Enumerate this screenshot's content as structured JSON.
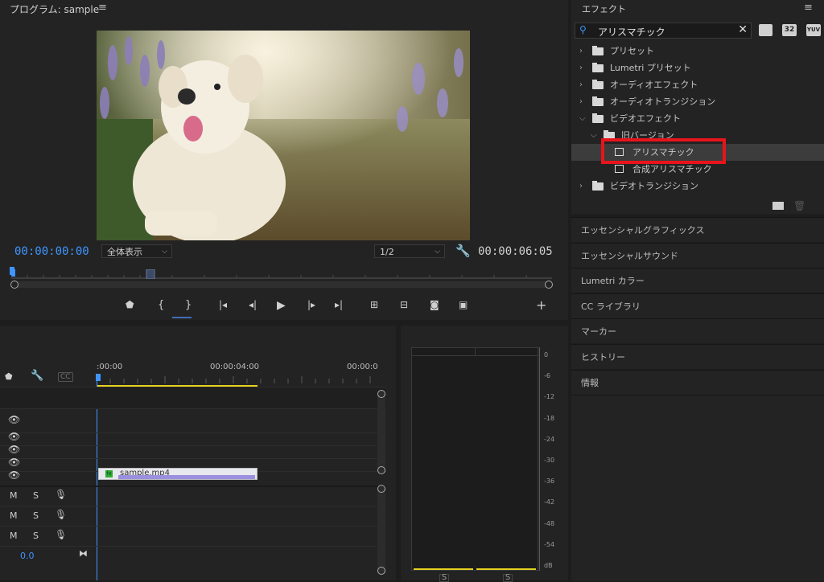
{
  "program": {
    "title": "プログラム: sample",
    "menu_icon": "hamburger-menu-icon",
    "timecode_current": "00:00:00:00",
    "timecode_duration": "00:00:06:05",
    "zoom_select": "全体表示",
    "resolution_select": "1/2"
  },
  "timeline": {
    "ruler": [
      "00:00",
      "00:00:04:00",
      "00:00:0"
    ],
    "ruler_prefix": ":",
    "clip_name": "sample.mp4",
    "clip_badge": "fx",
    "track_M": "M",
    "track_S": "S",
    "volume": "0.0",
    "cc_label": "CC"
  },
  "meter": {
    "scale": [
      "0",
      "-6",
      "-12",
      "-18",
      "-24",
      "-30",
      "-36",
      "-42",
      "-48",
      "-54",
      "dB"
    ],
    "solo_left": "S",
    "solo_right": "S"
  },
  "effects": {
    "title": "エフェクト",
    "search_value": "アリスマチック",
    "btn_32": "32",
    "btn_yuv": "YUV",
    "tree": [
      {
        "label": "プリセット",
        "indent": 0,
        "expanded": false
      },
      {
        "label": "Lumetri プリセット",
        "indent": 0,
        "expanded": false
      },
      {
        "label": "オーディオエフェクト",
        "indent": 0,
        "expanded": false
      },
      {
        "label": "オーディオトランジション",
        "indent": 0,
        "expanded": false
      },
      {
        "label": "ビデオエフェクト",
        "indent": 0,
        "expanded": true
      },
      {
        "label": "旧バージョン",
        "indent": 1,
        "expanded": true
      },
      {
        "label": "アリスマチック",
        "indent": 2,
        "selected": true
      },
      {
        "label": "合成アリスマチック",
        "indent": 2
      },
      {
        "label": "ビデオトランジション",
        "indent": 0,
        "expanded": false
      }
    ]
  },
  "side_panels": [
    "エッセンシャルグラフィックス",
    "エッセンシャルサウンド",
    "Lumetri カラー",
    "CC ライブラリ",
    "マーカー",
    "ヒストリー",
    "情報"
  ],
  "colors": {
    "accent_blue": "#3f95ff",
    "highlight_red": "#e8141b",
    "timeline_yellow": "#e6d21e",
    "clip_purple": "#9b8fe0"
  }
}
